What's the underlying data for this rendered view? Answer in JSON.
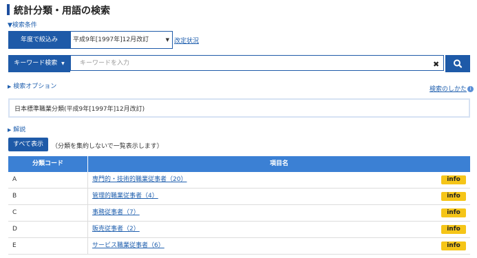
{
  "header": {
    "title": "統計分類・用語の検索"
  },
  "conditions": {
    "toggle_label": "▼検索条件",
    "year_label": "年度で絞込み",
    "year_value": "平成9年[1997年]12月改訂",
    "revision_link": "改定状況",
    "keyword_button": "キーワード検索",
    "keyword_placeholder": "キーワードを入力",
    "options_toggle": "検索オプション",
    "how_to_link": "検索のしかた"
  },
  "classification": {
    "name": "日本標準職業分類(平成9年[1997年]12月改訂)",
    "explanation_toggle": "解説"
  },
  "actions": {
    "show_all_label": "すべて表示",
    "show_all_note": "（分類を集約しないで一覧表示します）"
  },
  "table": {
    "headers": [
      "分類コード",
      "項目名"
    ],
    "info_label": "info",
    "rows": [
      {
        "code": "A",
        "name": "専門的・技術的職業従事者（20）"
      },
      {
        "code": "B",
        "name": "管理的職業従事者（4）"
      },
      {
        "code": "C",
        "name": "事務従事者（7）"
      },
      {
        "code": "D",
        "name": "販売従事者（2）"
      },
      {
        "code": "E",
        "name": "サービス職業従事者（6）"
      }
    ]
  }
}
